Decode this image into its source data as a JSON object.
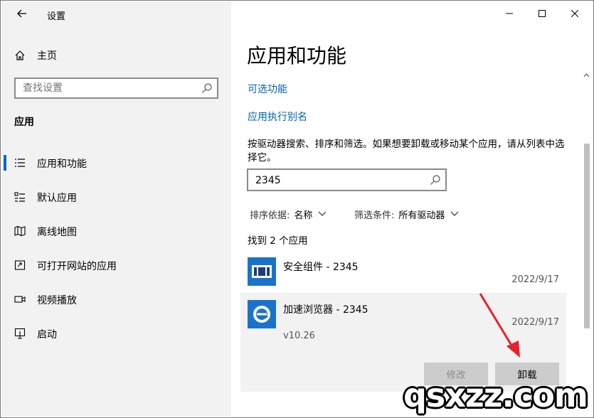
{
  "window": {
    "title": "设置",
    "controls": {
      "minimize": "minimize",
      "maximize": "maximize",
      "close": "close"
    }
  },
  "sidebar": {
    "home_label": "主页",
    "search_placeholder": "查找设置",
    "section_title": "应用",
    "items": [
      {
        "label": "应用和功能",
        "icon": "list-icon",
        "active": true
      },
      {
        "label": "默认应用",
        "icon": "default-apps-icon",
        "active": false
      },
      {
        "label": "离线地图",
        "icon": "map-icon",
        "active": false
      },
      {
        "label": "可打开网站的应用",
        "icon": "open-window-icon",
        "active": false
      },
      {
        "label": "视频播放",
        "icon": "video-icon",
        "active": false
      },
      {
        "label": "启动",
        "icon": "startup-icon",
        "active": false
      }
    ]
  },
  "main": {
    "title": "应用和功能",
    "links": [
      "可选功能",
      "应用执行别名"
    ],
    "description": "按驱动器搜索、排序和筛选。如果想要卸载或移动某个应用，请从列表中选择它。",
    "filter_value": "2345",
    "sort": {
      "key": "排序依据:",
      "value": "名称"
    },
    "drive_filter": {
      "key": "筛选条件:",
      "value": "所有驱动器"
    },
    "found_text": "找到 2 个应用",
    "apps": [
      {
        "name": "安全组件 - 2345",
        "date": "2022/9/17",
        "icon": "security-component-icon"
      },
      {
        "name": "加速浏览器 - 2345",
        "date": "2022/9/17",
        "version": "v10.26",
        "icon": "browser-icon"
      }
    ],
    "modify_label": "修改",
    "uninstall_label": "卸载"
  },
  "watermark": "qsxzz.com",
  "colors": {
    "accent": "#0067c0",
    "link": "#0063b1",
    "arrow": "#e8202a",
    "app_icon_bg": "#1a73c9"
  }
}
